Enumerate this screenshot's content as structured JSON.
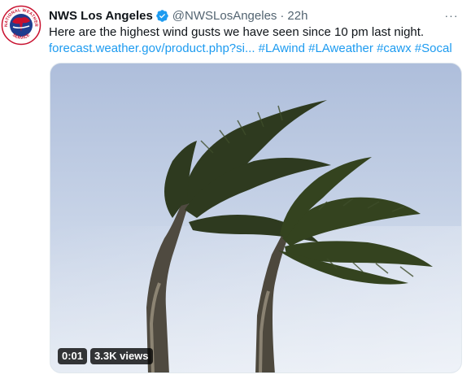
{
  "tweet": {
    "display_name": "NWS Los Angeles",
    "handle": "@NWSLosAngeles",
    "separator": "·",
    "time": "22h",
    "more_label": "···",
    "text": "Here are the highest wind gusts we have seen since 10 pm last night.",
    "link_text": "forecast.weather.gov/product.php?si...",
    "hashtags": [
      "#LAwind",
      "#LAweather",
      "#cawx",
      "#Socal"
    ],
    "avatar": {
      "top_text": "NATIONAL WEATHER",
      "bottom_text": "SERVICE"
    }
  },
  "media": {
    "type": "video",
    "timestamp": "0:01",
    "views": "3.3K views"
  },
  "colors": {
    "link": "#1d9bf0",
    "verified": "#1d9bf0",
    "text_primary": "#0f1419",
    "text_secondary": "#536471",
    "sky": "#c9d6ea"
  },
  "icons": {
    "verified": "verified-badge-icon",
    "more": "more-horizontal-icon",
    "avatar_logo": "nws-logo-icon"
  }
}
